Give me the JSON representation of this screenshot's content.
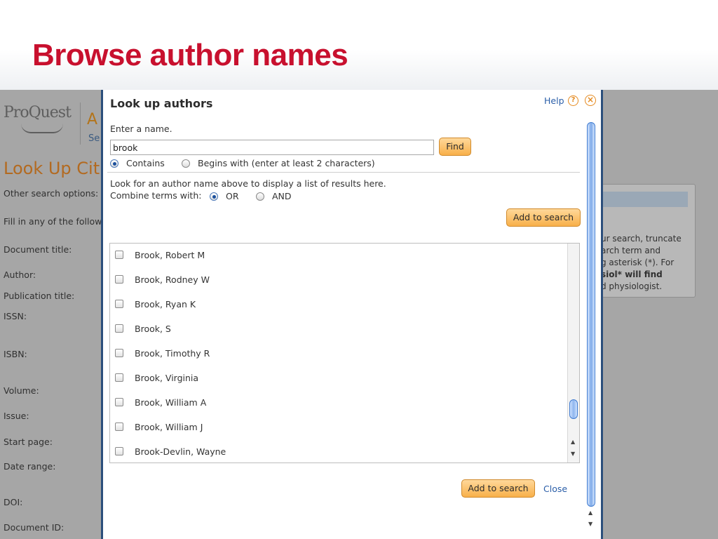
{
  "slide": {
    "title": "Browse author names"
  },
  "background": {
    "logo": "ProQuest",
    "app_letter": "A",
    "app_sub": "Se",
    "page_title": "Look Up Cit",
    "labels": [
      "Other search options:",
      "Fill in any of the follow",
      "Document title:",
      "Author:",
      "Publication title:",
      "ISSN:",
      "ISBN:",
      "Volume:",
      "Issue:",
      "Start page:",
      "Date range:",
      "DOI:",
      "Document ID:"
    ],
    "tip_lines": [
      "ur search, truncate",
      "arch term and",
      "g asterisk (*).  For",
      "siol* will find",
      "d physiologist."
    ]
  },
  "modal": {
    "title": "Look up authors",
    "help_label": "Help",
    "help_icon": "?",
    "close_icon": "×",
    "enter_label": "Enter a name.",
    "name_value": "brook",
    "find_label": "Find",
    "match_options": [
      {
        "label": "Contains",
        "selected": true
      },
      {
        "label": "Begins with (enter at least 2 characters)",
        "selected": false
      }
    ],
    "info_text": "Look for an author name above to display a list of results here.",
    "combine_label": "Combine terms with:",
    "combine_options": [
      {
        "label": "OR",
        "selected": true
      },
      {
        "label": "AND",
        "selected": false
      }
    ],
    "add_to_search_label": "Add to search",
    "results": [
      "Brook, Robert M",
      "Brook, Rodney W",
      "Brook, Ryan K",
      "Brook, S",
      "Brook, Timothy R",
      "Brook, Virginia",
      "Brook, William A",
      "Brook, William J",
      "Brook-Devlin, Wayne"
    ],
    "close_label": "Close",
    "scroll_up": "▲",
    "scroll_down": "▼"
  },
  "colors": {
    "title_red": "#c8102e",
    "button_orange": "#f8b04a",
    "link_blue": "#2a5ea8",
    "modal_border": "#2c4f7c"
  },
  "icons": [
    "help-circle-icon",
    "close-circle-icon",
    "checkbox-icon",
    "radio-icon"
  ]
}
